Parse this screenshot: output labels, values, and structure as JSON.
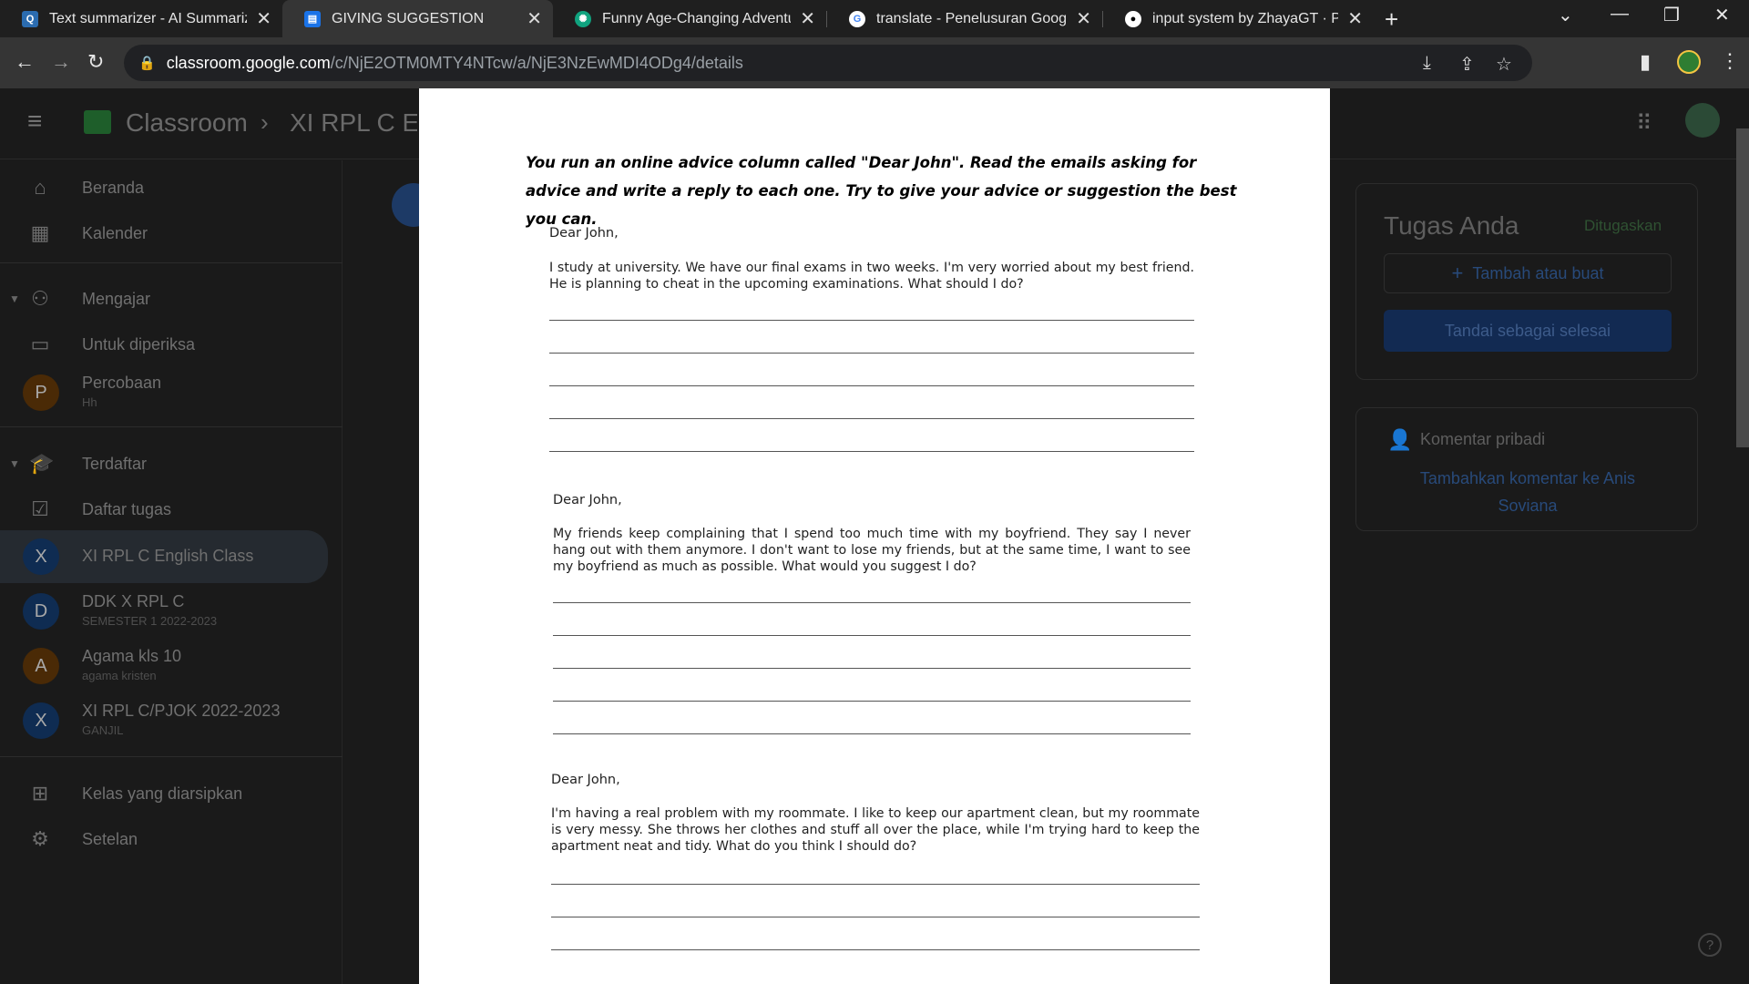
{
  "browser": {
    "tabs": [
      {
        "title": "Text summarizer - AI Summarizin",
        "icon": "quillbot-icon",
        "active": false
      },
      {
        "title": "GIVING SUGGESTION",
        "icon": "classroom-assignment-icon",
        "active": true
      },
      {
        "title": "Funny Age-Changing Adventure",
        "icon": "chatgpt-icon",
        "active": false
      },
      {
        "title": "translate - Penelusuran Google",
        "icon": "google-icon",
        "active": false
      },
      {
        "title": "input system by ZhayaGT · Pull Re",
        "icon": "github-icon",
        "active": false
      }
    ],
    "url_host": "classroom.google.com",
    "url_path": "/c/NjE2OTM0MTY4NTcw/a/NjE3NzEwMDI4ODg4/details"
  },
  "classroom": {
    "brand": "Classroom",
    "breadcrumb": "XI RPL C English Class",
    "sidebar": {
      "home": "Beranda",
      "calendar": "Kalender",
      "teaching": "Mengajar",
      "to_review": "Untuk diperiksa",
      "class_percobaan": {
        "initial": "P",
        "name": "Percobaan",
        "sub": "Hh"
      },
      "enrolled": "Terdaftar",
      "todo": "Daftar tugas",
      "classes": [
        {
          "initial": "X",
          "name": "XI RPL C English Class",
          "sub": ""
        },
        {
          "initial": "D",
          "name": "DDK X RPL C",
          "sub": "SEMESTER 1 2022-2023"
        },
        {
          "initial": "A",
          "name": "Agama kls 10",
          "sub": "agama kristen"
        },
        {
          "initial": "X",
          "name": "XI RPL C/PJOK 2022-2023",
          "sub": "GANJIL"
        }
      ],
      "archived": "Kelas yang diarsipkan",
      "settings": "Setelan"
    },
    "your_work": {
      "title": "Tugas Anda",
      "status": "Ditugaskan",
      "add_button": "Tambah atau buat",
      "mark_done_button": "Tandai sebagai selesai"
    },
    "private_comments": {
      "title": "Komentar pribadi",
      "add_link": "Tambahkan komentar ke Anis Soviana"
    },
    "help": "?"
  },
  "document": {
    "instruction": "You run an online advice column called \"Dear John\". Read the emails asking for advice and write a reply to each one. Try to give your advice or suggestion the best you can.",
    "letters": [
      {
        "greeting": "Dear John,",
        "body": "I study at university. We have our final exams in two weeks. I'm very worried about my best friend. He is planning to cheat in the upcoming examinations. What should I do?"
      },
      {
        "greeting": "Dear John,",
        "body": "My friends keep complaining that I spend too much time with my boyfriend. They say I never hang out with them anymore. I don't want to lose my friends, but at the same time, I want to see my boyfriend as much as possible. What would you suggest I do?"
      },
      {
        "greeting": "Dear John,",
        "body": "I'm having a real problem with my roommate. I like to keep our apartment clean, but my roommate is very messy. She throws her clothes and stuff all over the place, while I'm trying hard to keep the apartment neat and tidy. What do you think I should do?"
      }
    ]
  }
}
